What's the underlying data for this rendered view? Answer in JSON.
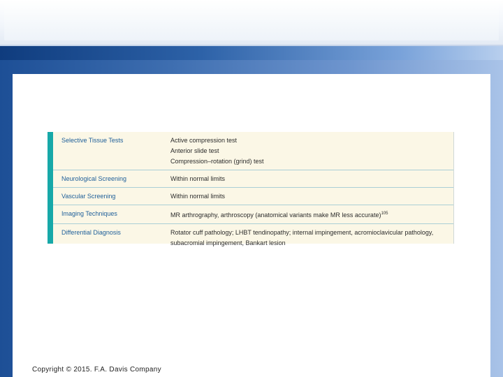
{
  "table": {
    "rows": [
      {
        "label": "Selective Tissue Tests",
        "lines": [
          "Active compression test",
          "Anterior slide test",
          "Compression–rotation (grind) test"
        ]
      },
      {
        "label": "Neurological Screening",
        "lines": [
          "Within normal limits"
        ]
      },
      {
        "label": "Vascular Screening",
        "lines": [
          "Within normal limits"
        ]
      },
      {
        "label": "Imaging Techniques",
        "lines": [
          "MR arthrography, arthroscopy (anatomical variants make MR less accurate)"
        ],
        "superscript": "105"
      },
      {
        "label": "Differential Diagnosis",
        "lines": [
          "Rotator cuff pathology; LHBT tendinopathy; internal impingement, acromioclavicular pathology,",
          "subacromial impingement, Bankart lesion"
        ]
      }
    ]
  },
  "footer": {
    "copyright": "Copyright © 2015. F.A. Davis Company"
  },
  "colors": {
    "accent": "#17a8a8",
    "label_text": "#20609a",
    "table_bg": "#fbf7e6"
  }
}
